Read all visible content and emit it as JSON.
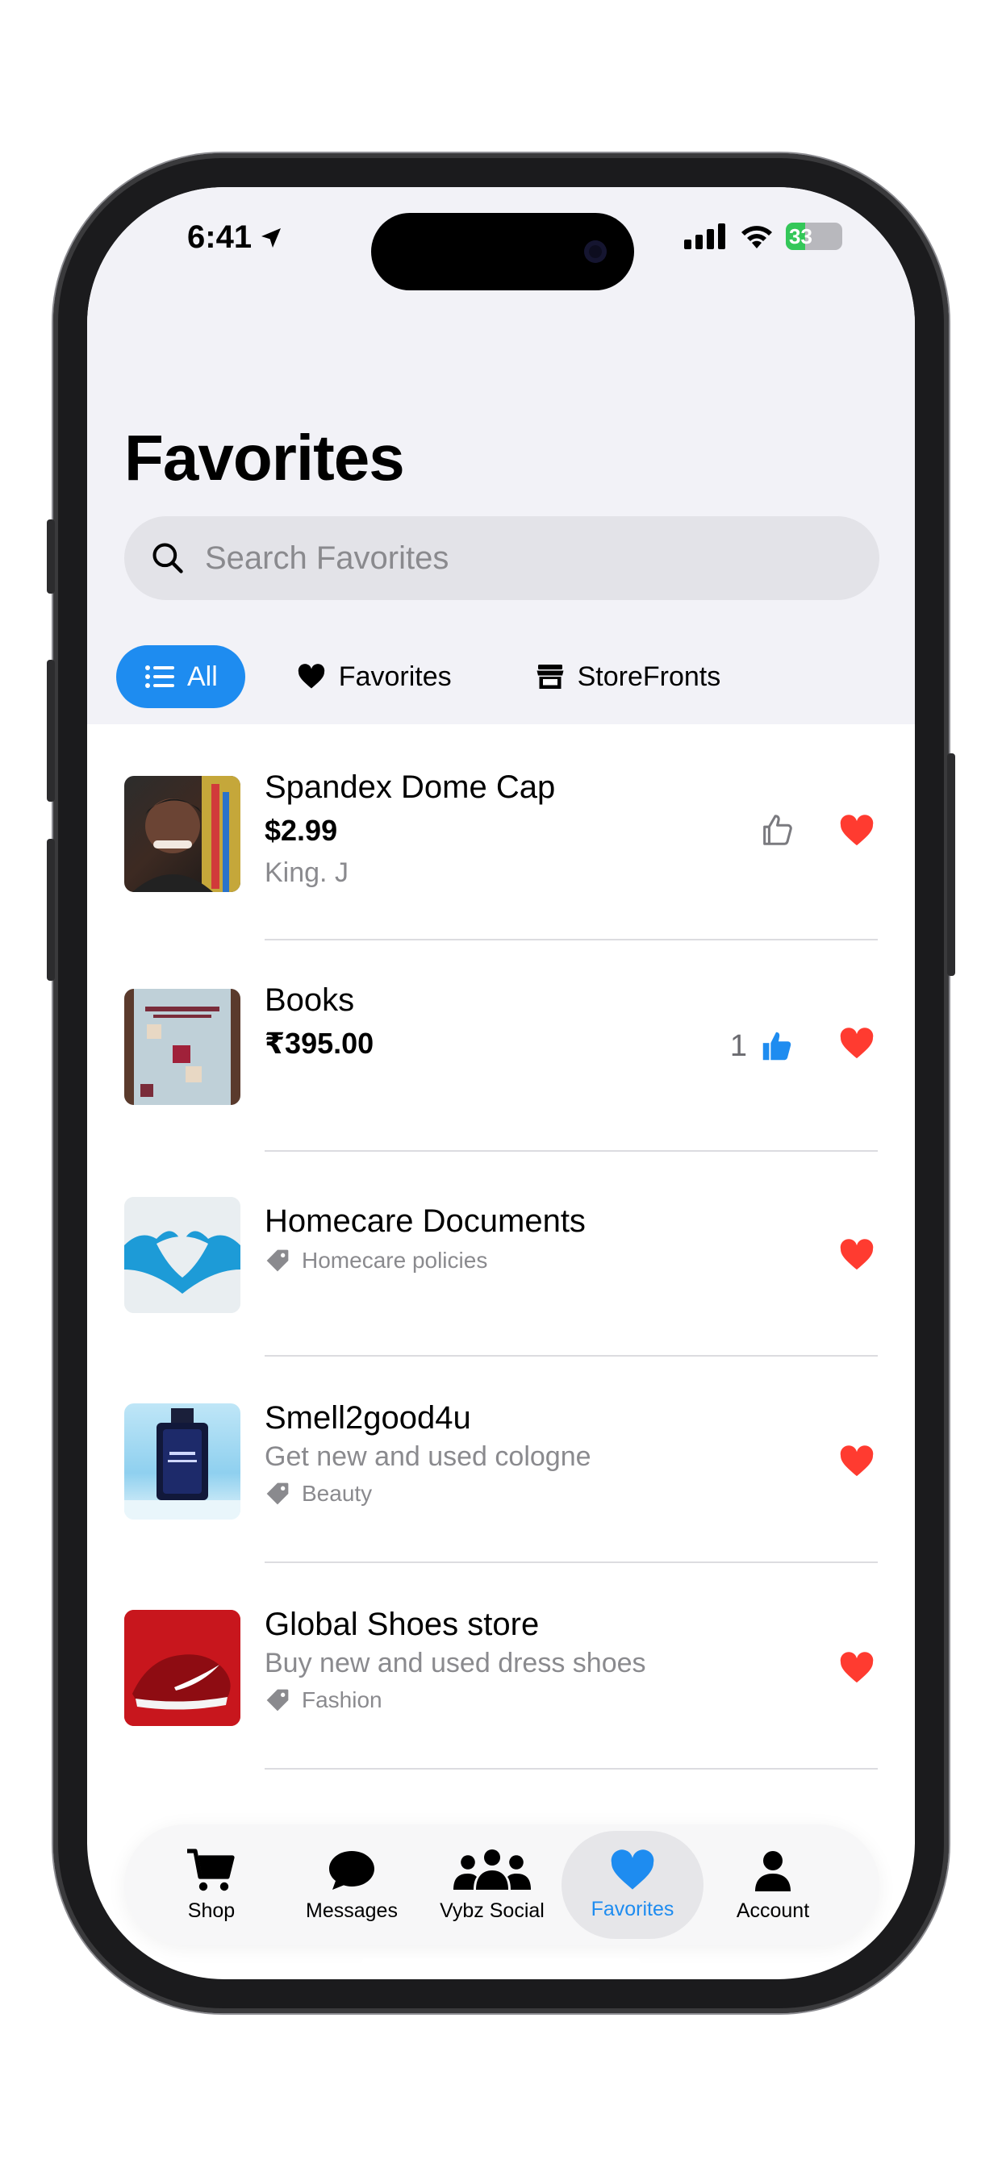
{
  "status_bar": {
    "time": "6:41",
    "battery": "33"
  },
  "header": {
    "title": "Favorites"
  },
  "search": {
    "placeholder": "Search Favorites"
  },
  "filters": [
    {
      "label": "All",
      "icon": "list-icon",
      "active": true
    },
    {
      "label": "Favorites",
      "icon": "heart-icon",
      "active": false
    },
    {
      "label": "StoreFronts",
      "icon": "storefront-icon",
      "active": false
    }
  ],
  "items": [
    {
      "title": "Spandex Dome Cap",
      "price": "$2.99",
      "seller": "King. J",
      "liked": false,
      "like_count": ""
    },
    {
      "title": "Books",
      "price": "₹395.00",
      "liked": true,
      "like_count": "1"
    },
    {
      "title": "Homecare Documents",
      "category": "Homecare policies"
    },
    {
      "title": "Smell2good4u",
      "subtitle": "Get new and used cologne",
      "category": "Beauty"
    },
    {
      "title": "Global Shoes store",
      "subtitle": "Buy new and used dress shoes",
      "category": "Fashion"
    }
  ],
  "tabbar": {
    "shop": "Shop",
    "messages": "Messages",
    "social": "Vybz Social",
    "favorites": "Favorites",
    "account": "Account",
    "active": "favorites"
  },
  "colors": {
    "accent": "#1e8cf0",
    "heart": "#ff3b30",
    "background": "#f2f2f7"
  }
}
